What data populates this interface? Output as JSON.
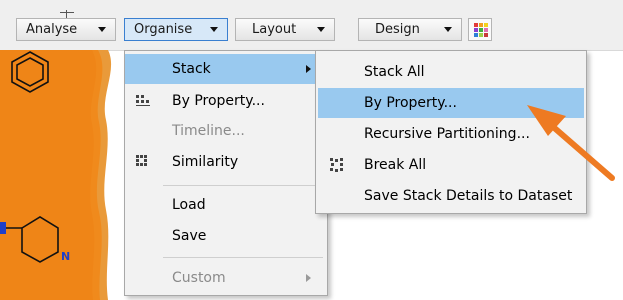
{
  "toolbar": {
    "analyse_label": "Analyse",
    "organise_label": "Organise",
    "layout_label": "Layout",
    "design_label": "Design",
    "palette_icon": "color-palette-icon"
  },
  "organise_menu": {
    "items": [
      {
        "label": "Stack",
        "has_submenu": true,
        "highlighted": true
      },
      {
        "label": "By Property...",
        "icon": "by-property-icon"
      },
      {
        "label": "Timeline...",
        "disabled": true
      },
      {
        "label": "Similarity",
        "icon": "similarity-icon"
      },
      {
        "label": "Load"
      },
      {
        "label": "Save"
      },
      {
        "label": "Custom",
        "disabled": true,
        "has_submenu": true
      }
    ]
  },
  "stack_submenu": {
    "items": [
      {
        "label": "Stack All"
      },
      {
        "label": "By Property...",
        "highlighted": true
      },
      {
        "label": "Recursive Partitioning..."
      },
      {
        "label": "Break All",
        "icon": "break-all-icon"
      },
      {
        "label": "Save Stack Details to Dataset"
      }
    ]
  },
  "molecule_card": {
    "atom_label": "N",
    "card_color": "#f08a1c",
    "atom_color": "#1f3fc8"
  },
  "colors": {
    "highlight": "#99c9ef",
    "annotation_arrow": "#ee7a22",
    "menu_bg": "#f2f2f2"
  }
}
